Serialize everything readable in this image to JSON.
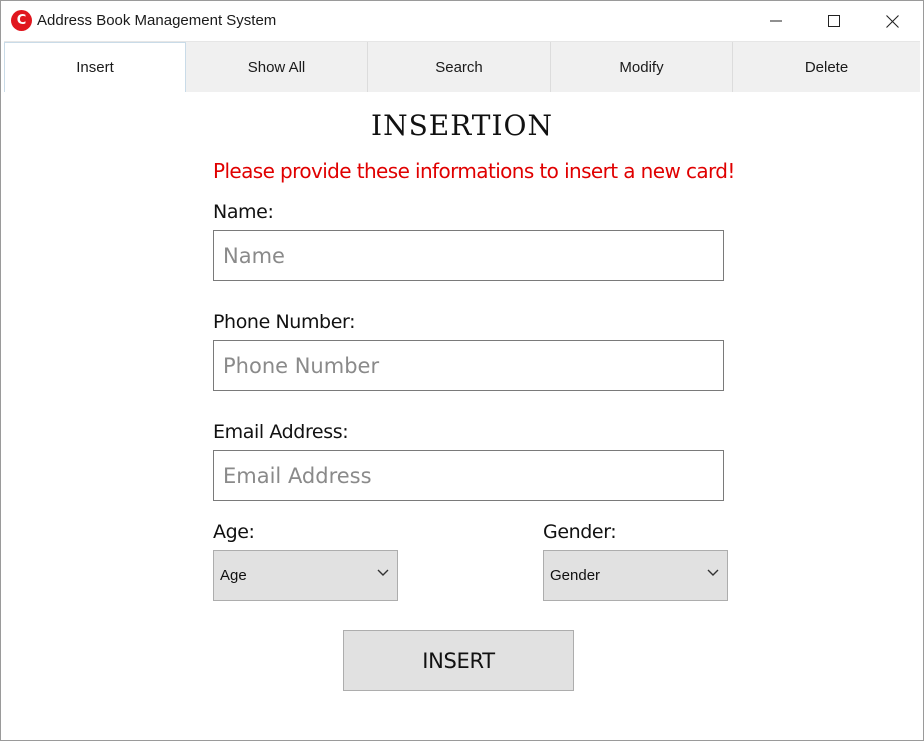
{
  "window": {
    "title": "Address Book Management System",
    "icon_letter": "C",
    "icon_color": "#e0161e"
  },
  "tabs": [
    {
      "label": "Insert",
      "active": true
    },
    {
      "label": "Show All",
      "active": false
    },
    {
      "label": "Search",
      "active": false
    },
    {
      "label": "Modify",
      "active": false
    },
    {
      "label": "Delete",
      "active": false
    }
  ],
  "form": {
    "heading": "INSERTION",
    "notice": "Please provide these informations to insert a new card!",
    "notice_color": "#e00000",
    "name": {
      "label": "Name:",
      "placeholder": "Name",
      "value": ""
    },
    "phone": {
      "label": "Phone Number:",
      "placeholder": "Phone Number",
      "value": ""
    },
    "email": {
      "label": "Email Address:",
      "placeholder": "Email Address",
      "value": ""
    },
    "age": {
      "label": "Age:",
      "selected": "Age"
    },
    "gender": {
      "label": "Gender:",
      "selected": "Gender"
    },
    "submit_label": "INSERT"
  },
  "icons": {
    "app": "app-logo-icon",
    "minimize": "minimize-icon",
    "maximize": "maximize-icon",
    "close": "close-icon",
    "dropdown": "chevron-down-icon"
  }
}
